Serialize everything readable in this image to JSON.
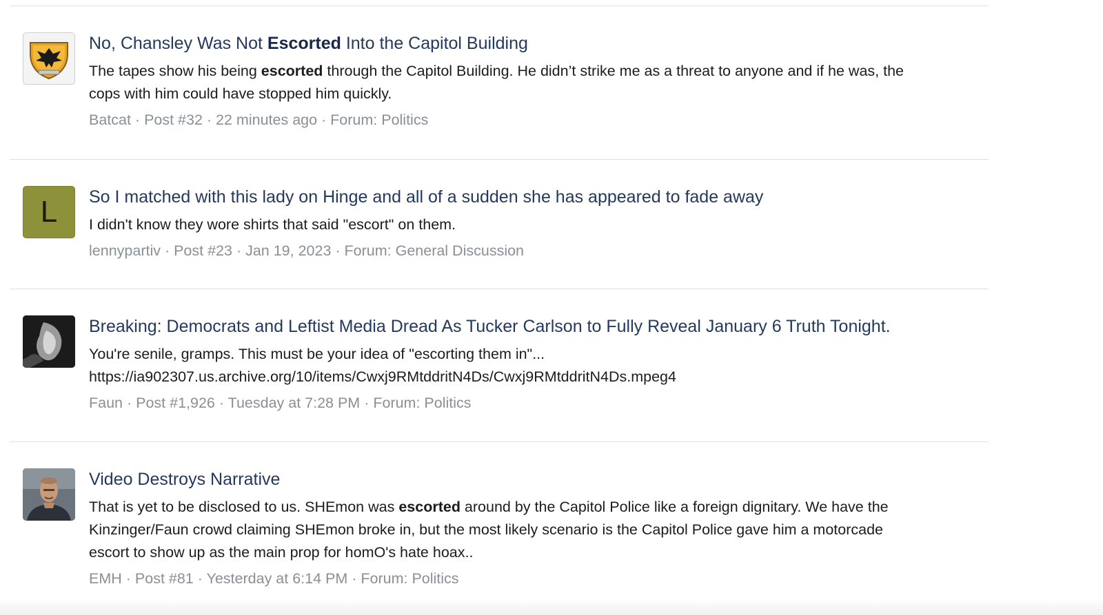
{
  "results": [
    {
      "title_parts": [
        "No, Chansley Was Not ",
        "Escorted",
        " Into the Capitol Building"
      ],
      "snippet_lines": [
        [
          "The tapes show his being ",
          "escorted",
          " through the Capitol Building. He didn’t strike me as a threat to anyone and if he was, the"
        ],
        [
          "cops with him could have stopped him quickly.",
          "",
          ""
        ]
      ],
      "author": "Batcat",
      "post": "Post #32",
      "time": "22 minutes ago",
      "forum": "Forum: Politics",
      "avatar": "crest-eagle-icon",
      "sep": " · "
    },
    {
      "title_parts": [
        "So I matched with this lady on Hinge and all of a sudden she has appeared to fade away",
        "",
        ""
      ],
      "snippet_lines": [
        [
          "I didn't know they wore shirts that said \"escort\" on them.",
          "",
          ""
        ]
      ],
      "author": "lennypartiv",
      "post": "Post #23",
      "time": "Jan 19, 2023",
      "forum": "Forum: General Discussion",
      "avatar_letter": "L",
      "avatar_color": "#8d913a",
      "sep": " · "
    },
    {
      "title_parts": [
        "Breaking: Democrats and Leftist Media Dread As Tucker Carlson to Fully Reveal January 6 Truth Tonight.",
        "",
        ""
      ],
      "snippet_lines": [
        [
          "You're senile, gramps. This must be your idea of \"escorting them in\"...",
          "",
          ""
        ],
        [
          "https://ia902307.us.archive.org/10/items/Cwxj9RMtddritN4Ds/Cwxj9RMtddritN4Ds.mpeg4",
          "",
          ""
        ]
      ],
      "author": "Faun",
      "post": "Post #1,926",
      "time": "Tuesday at 7:28 PM",
      "forum": "Forum: Politics",
      "avatar": "dark-photo-icon",
      "sep": " · "
    },
    {
      "title_parts": [
        "Video Destroys Narrative",
        "",
        ""
      ],
      "snippet_lines": [
        [
          "That is yet to be disclosed to us. SHEmon was ",
          "escorted",
          " around by the Capitol Police like a foreign dignitary. We have the"
        ],
        [
          "Kinzinger/Faun crowd claiming SHEmon broke in, but the most likely scenario is the Capitol Police gave him a motorcade",
          "",
          ""
        ],
        [
          "escort to show up as the main prop for homO's hate hoax..",
          "",
          ""
        ]
      ],
      "author": "EMH",
      "post": "Post #81",
      "time": "Yesterday at 6:14 PM",
      "forum": "Forum: Politics",
      "avatar": "man-photo-icon",
      "sep": " · "
    }
  ]
}
